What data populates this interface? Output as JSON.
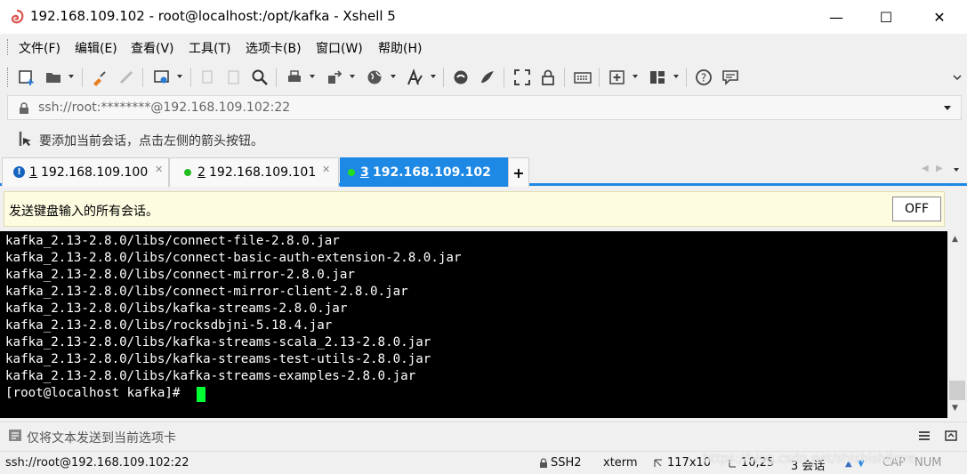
{
  "window": {
    "title": "192.168.109.102 - root@localhost:/opt/kafka - Xshell 5",
    "minimize": "—",
    "maximize": "☐",
    "close": "✕"
  },
  "menu": [
    "文件(F)",
    "编辑(E)",
    "查看(V)",
    "工具(T)",
    "选项卡(B)",
    "窗口(W)",
    "帮助(H)"
  ],
  "address": {
    "text": "ssh://root:********@192.168.109.102:22"
  },
  "hint": {
    "text": "要添加当前会话，点击左侧的箭头按钮。"
  },
  "tabs": [
    {
      "number": "1",
      "label": "192.168.109.100",
      "status": "warning"
    },
    {
      "number": "2",
      "label": "192.168.109.101",
      "status": "connected"
    },
    {
      "number": "3",
      "label": "192.168.109.102",
      "status": "connected",
      "active": true
    }
  ],
  "new_tab": "+",
  "broadcast": {
    "text": "发送键盘输入的所有会话。",
    "toggle_label": "OFF"
  },
  "terminal": {
    "lines": [
      "kafka_2.13-2.8.0/libs/connect-file-2.8.0.jar",
      "kafka_2.13-2.8.0/libs/connect-basic-auth-extension-2.8.0.jar",
      "kafka_2.13-2.8.0/libs/connect-mirror-2.8.0.jar",
      "kafka_2.13-2.8.0/libs/connect-mirror-client-2.8.0.jar",
      "kafka_2.13-2.8.0/libs/kafka-streams-2.8.0.jar",
      "kafka_2.13-2.8.0/libs/rocksdbjni-5.18.4.jar",
      "kafka_2.13-2.8.0/libs/kafka-streams-scala_2.13-2.8.0.jar",
      "kafka_2.13-2.8.0/libs/kafka-streams-test-utils-2.8.0.jar",
      "kafka_2.13-2.8.0/libs/kafka-streams-examples-2.8.0.jar"
    ],
    "prompt": "[root@localhost kafka]# "
  },
  "compose": {
    "text": "仅将文本发送到当前选项卡"
  },
  "status": {
    "connection": "ssh://root@192.168.109.102:22",
    "protocol": "SSH2",
    "terminal_type": "xterm",
    "size": "117x10",
    "position": "10,25",
    "sessions": "3 会话",
    "caps": "CAP",
    "num": "NUM"
  },
  "watermark": "https://blog.csdn.net/shishishilove",
  "colors": {
    "accent": "#1e88e5",
    "cursor": "#00ff33",
    "terminal_bg": "#000000",
    "terminal_fg": "#ffffff"
  }
}
